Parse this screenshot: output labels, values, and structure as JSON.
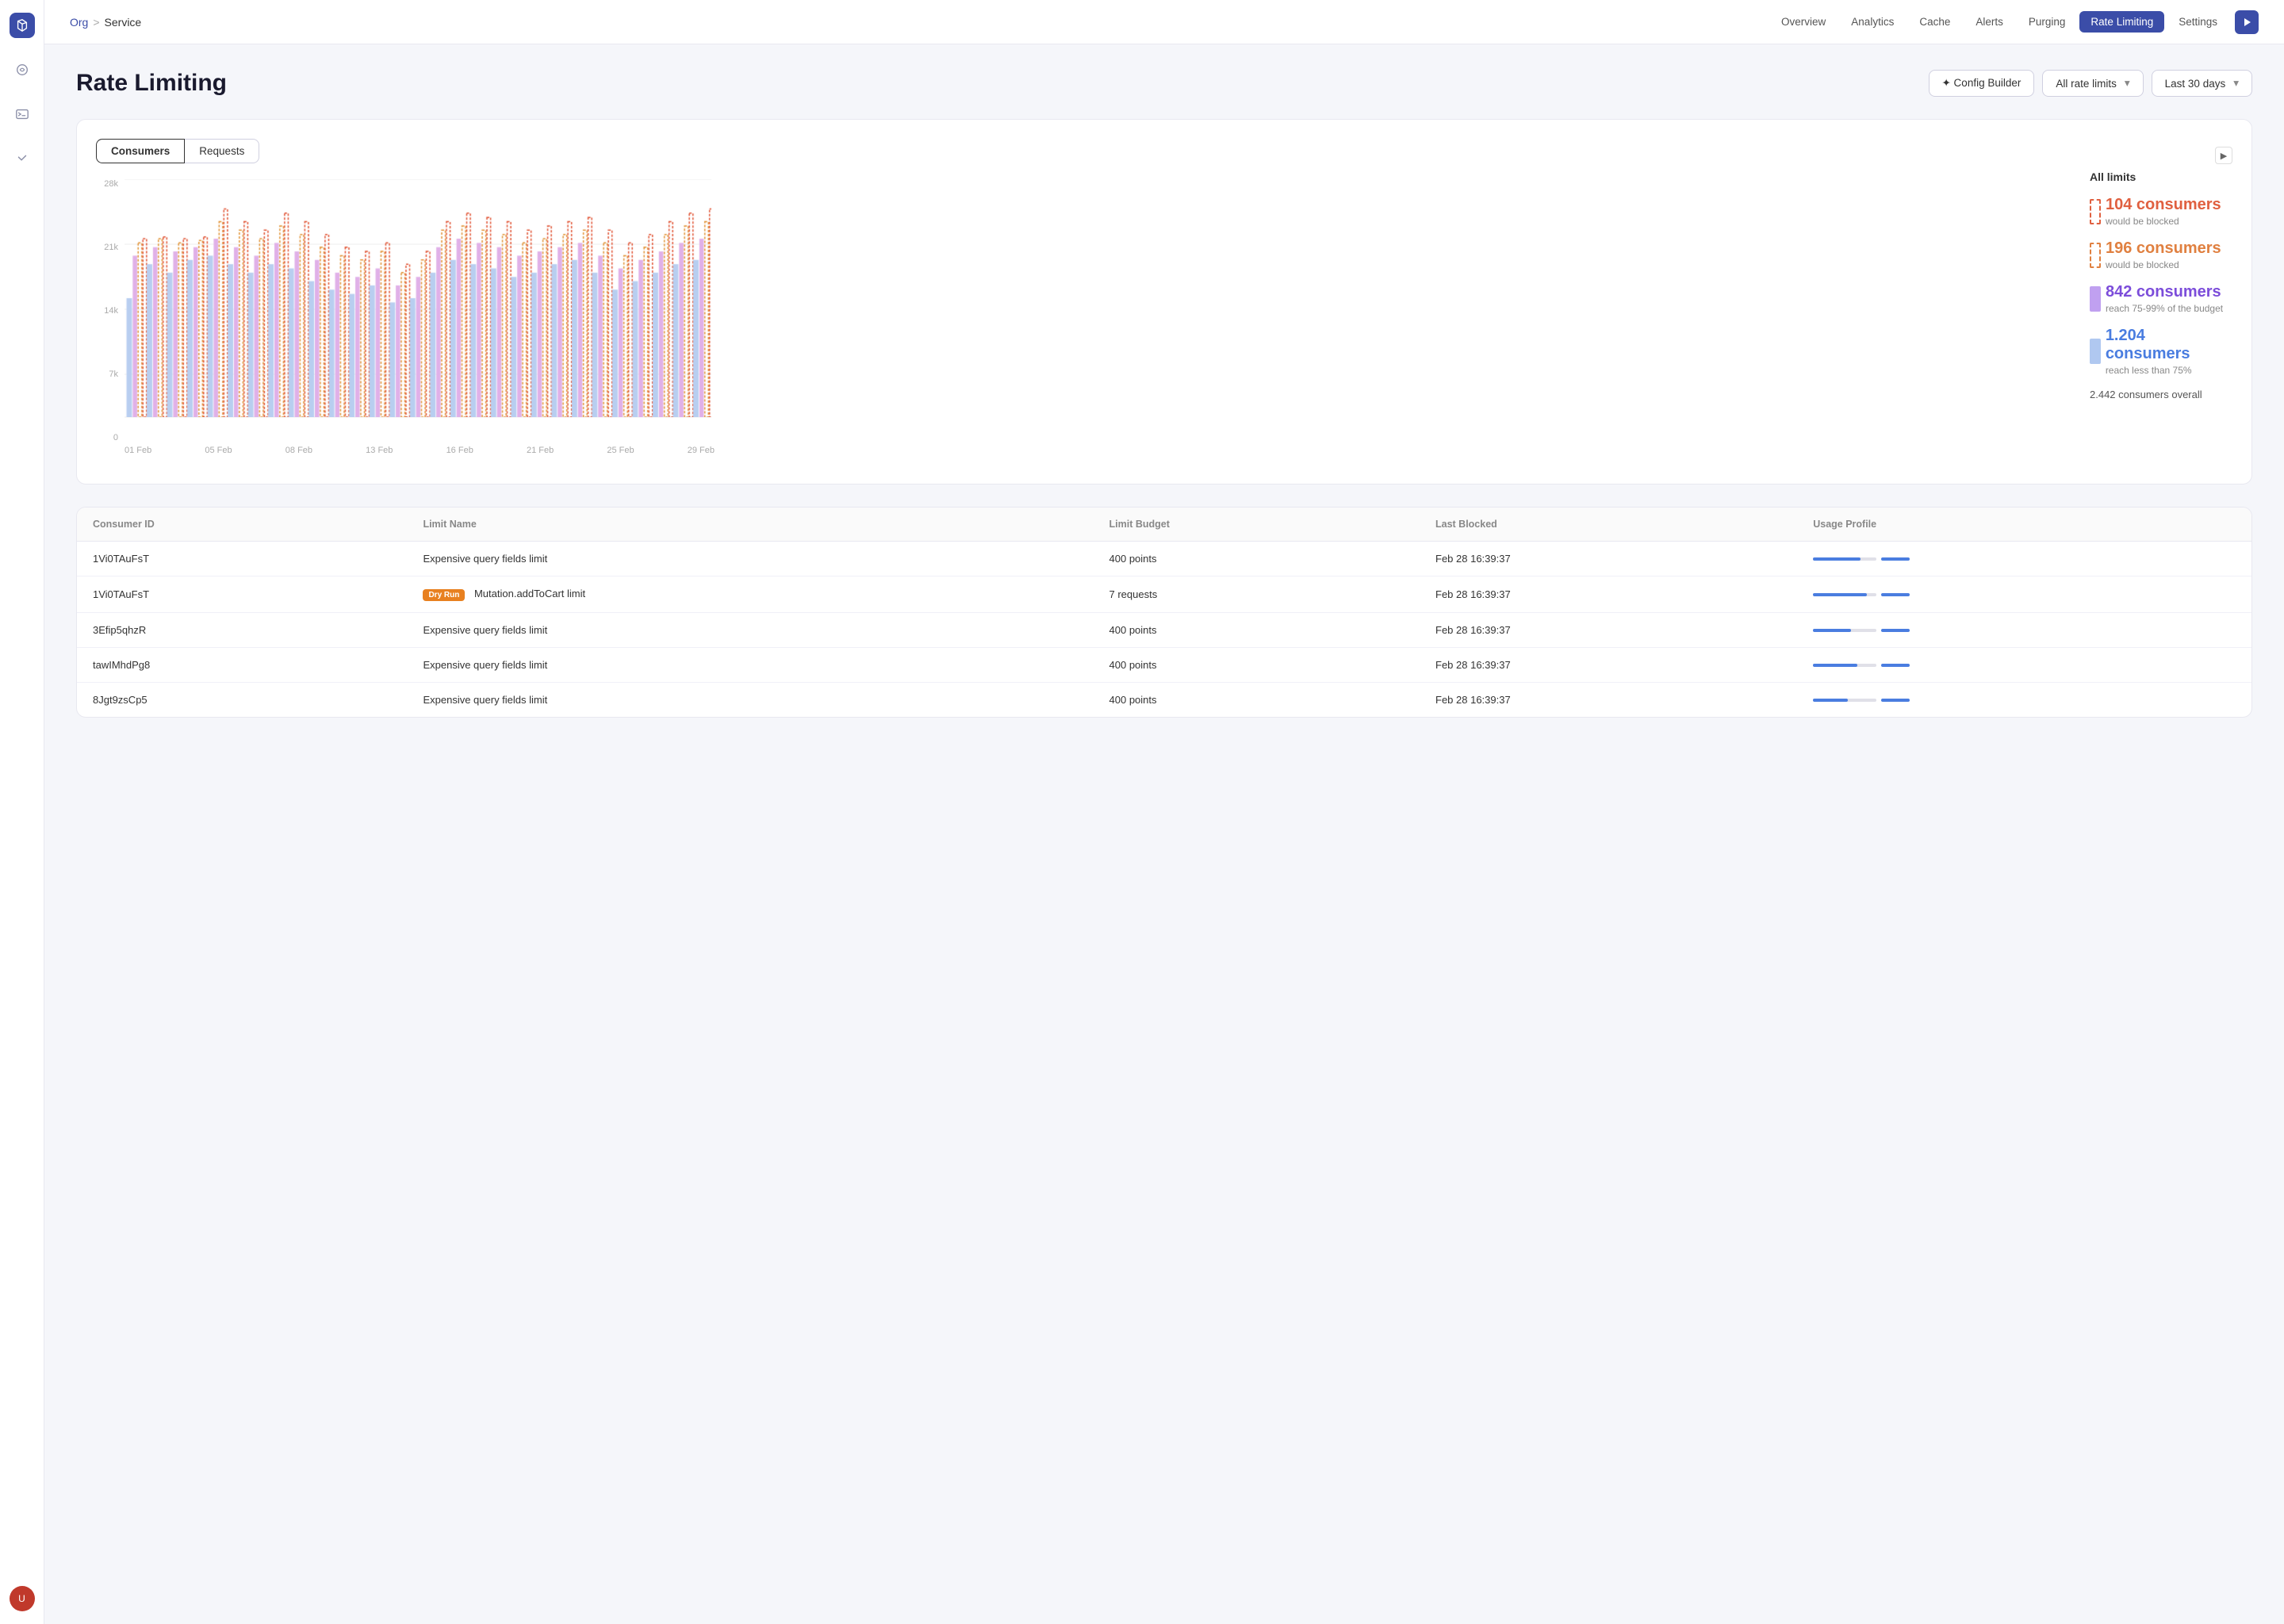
{
  "sidebar": {
    "logo": "S",
    "icons": [
      "ai-icon",
      "terminal-icon",
      "feedback-icon"
    ],
    "avatar_initials": "U"
  },
  "header": {
    "breadcrumb": {
      "org": "Org",
      "separator": ">",
      "service": "Service"
    },
    "nav": [
      {
        "label": "Overview",
        "active": false
      },
      {
        "label": "Analytics",
        "active": false
      },
      {
        "label": "Cache",
        "active": false
      },
      {
        "label": "Alerts",
        "active": false
      },
      {
        "label": "Purging",
        "active": false
      },
      {
        "label": "Rate Limiting",
        "active": true
      },
      {
        "label": "Settings",
        "active": false
      }
    ]
  },
  "page": {
    "title": "Rate Limiting",
    "actions": {
      "config_builder": "✦ Config Builder",
      "all_rate_limits": "All rate limits",
      "last_30_days": "Last 30 days"
    }
  },
  "chart": {
    "tabs": [
      "Consumers",
      "Requests"
    ],
    "active_tab": "Consumers",
    "y_labels": [
      "28k",
      "21k",
      "14k",
      "7k",
      "0"
    ],
    "x_labels": [
      "01 Feb",
      "05 Feb",
      "08 Feb",
      "13 Feb",
      "16 Feb",
      "21 Feb",
      "25 Feb",
      "29 Feb"
    ],
    "legend": {
      "title": "All limits",
      "items": [
        {
          "count": "104 consumers",
          "desc": "would be blocked",
          "color": "red"
        },
        {
          "count": "196 consumers",
          "desc": "would be blocked",
          "color": "orange"
        },
        {
          "count": "842 consumers",
          "desc": "reach 75-99% of\nthe budget",
          "color": "purple"
        },
        {
          "count": "1.204 consumers",
          "desc": "reach less than 75%",
          "color": "blue"
        }
      ],
      "total": "2.442 consumers overall"
    }
  },
  "table": {
    "columns": [
      "Consumer ID",
      "Limit Name",
      "Limit Budget",
      "Last Blocked",
      "Usage Profile"
    ],
    "rows": [
      {
        "consumer_id": "1Vi0TAuFsT",
        "limit_name": "Expensive query fields limit",
        "dry_run": false,
        "limit_budget": "400 points",
        "last_blocked": "Feb 28 16:39:37",
        "usage_pct": 75
      },
      {
        "consumer_id": "1Vi0TAuFsT",
        "limit_name": "Mutation.addToCart limit",
        "dry_run": true,
        "limit_budget": "7 requests",
        "last_blocked": "Feb 28 16:39:37",
        "usage_pct": 85
      },
      {
        "consumer_id": "3Efip5qhzR",
        "limit_name": "Expensive query fields limit",
        "dry_run": false,
        "limit_budget": "400 points",
        "last_blocked": "Feb 28 16:39:37",
        "usage_pct": 60
      },
      {
        "consumer_id": "tawIMhdPg8",
        "limit_name": "Expensive query fields limit",
        "dry_run": false,
        "limit_budget": "400 points",
        "last_blocked": "Feb 28 16:39:37",
        "usage_pct": 70
      },
      {
        "consumer_id": "8Jgt9zsCp5",
        "limit_name": "Expensive query fields limit",
        "dry_run": false,
        "limit_budget": "400 points",
        "last_blocked": "Feb 28 16:39:37",
        "usage_pct": 55
      }
    ],
    "dry_run_label": "Dry Run"
  }
}
